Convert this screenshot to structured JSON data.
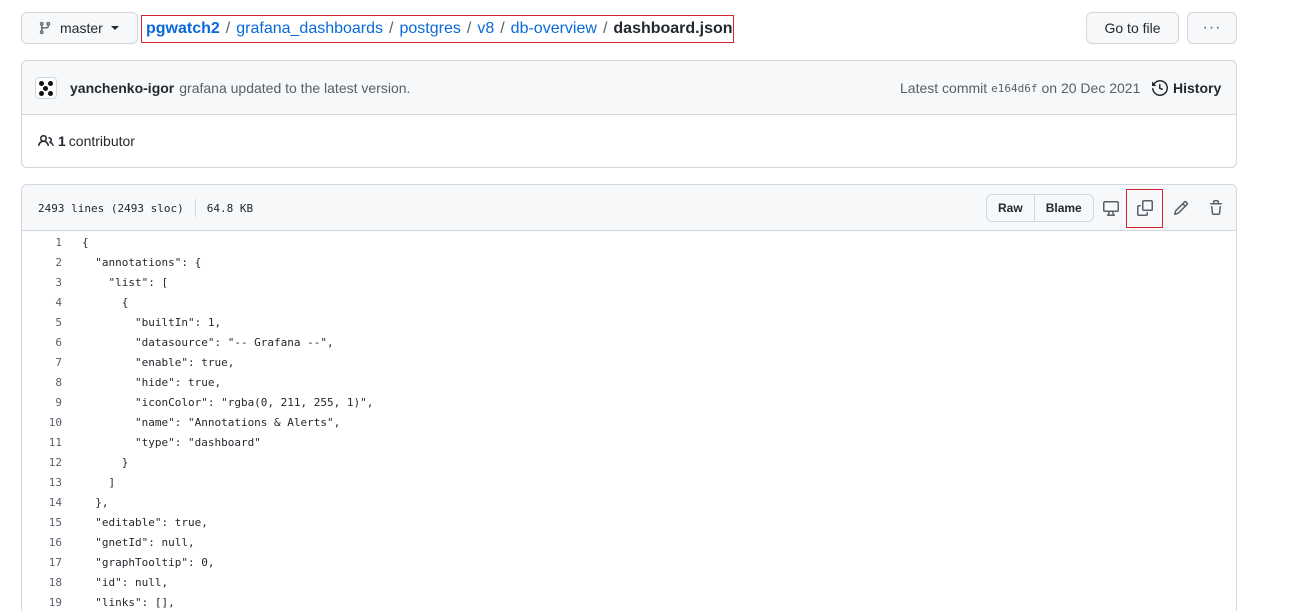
{
  "branch": {
    "label": "master"
  },
  "breadcrumb": {
    "repo": "pgwatch2",
    "parts": [
      "grafana_dashboards",
      "postgres",
      "v8",
      "db-overview"
    ],
    "separator": "/",
    "file": "dashboard.json"
  },
  "actions": {
    "go_to_file": "Go to file",
    "more": "···"
  },
  "commit": {
    "author": "yanchenko-igor",
    "message": "grafana updated to the latest version.",
    "latest_label": "Latest commit",
    "sha": "e164d6f",
    "date_prefix": "on",
    "date": "20 Dec 2021",
    "history": "History"
  },
  "contributors": {
    "count": "1",
    "label": "contributor"
  },
  "file": {
    "lines_info": "2493 lines (2493 sloc)",
    "size": "64.8 KB",
    "raw": "Raw",
    "blame": "Blame"
  },
  "code_lines": [
    {
      "n": "1",
      "text": "{"
    },
    {
      "n": "2",
      "text": "  \"annotations\": {"
    },
    {
      "n": "3",
      "text": "    \"list\": ["
    },
    {
      "n": "4",
      "text": "      {"
    },
    {
      "n": "5",
      "text": "        \"builtIn\": 1,"
    },
    {
      "n": "6",
      "text": "        \"datasource\": \"-- Grafana --\","
    },
    {
      "n": "7",
      "text": "        \"enable\": true,"
    },
    {
      "n": "8",
      "text": "        \"hide\": true,"
    },
    {
      "n": "9",
      "text": "        \"iconColor\": \"rgba(0, 211, 255, 1)\","
    },
    {
      "n": "10",
      "text": "        \"name\": \"Annotations & Alerts\","
    },
    {
      "n": "11",
      "text": "        \"type\": \"dashboard\""
    },
    {
      "n": "12",
      "text": "      }"
    },
    {
      "n": "13",
      "text": "    ]"
    },
    {
      "n": "14",
      "text": "  },"
    },
    {
      "n": "15",
      "text": "  \"editable\": true,"
    },
    {
      "n": "16",
      "text": "  \"gnetId\": null,"
    },
    {
      "n": "17",
      "text": "  \"graphTooltip\": 0,"
    },
    {
      "n": "18",
      "text": "  \"id\": null,"
    },
    {
      "n": "19",
      "text": "  \"links\": [],"
    }
  ],
  "colors": {
    "link": "#0969da",
    "highlight": "#d1242f",
    "border": "#d0d7de"
  }
}
